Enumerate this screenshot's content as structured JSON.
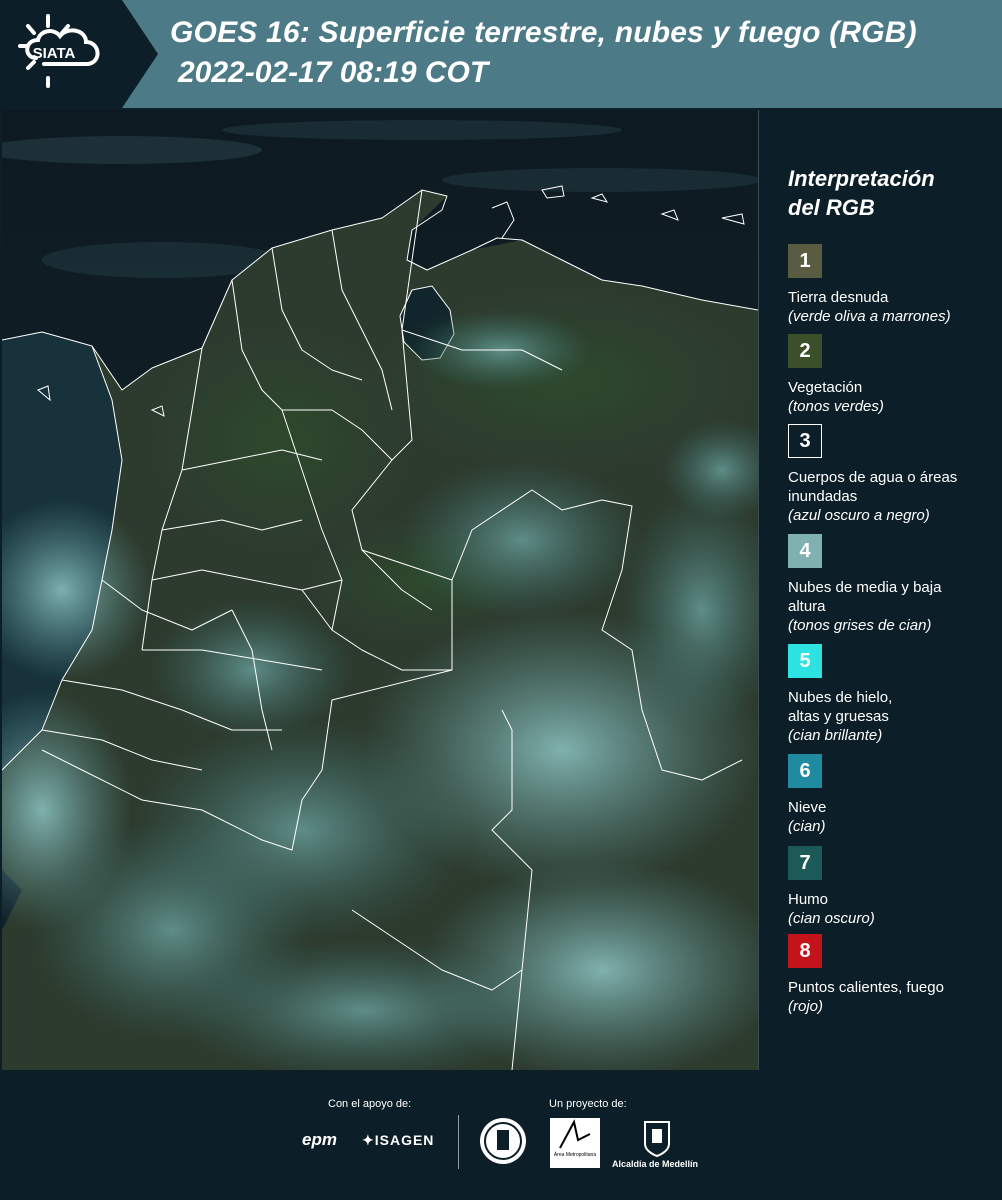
{
  "header": {
    "logo_text": "SIATA",
    "title": "GOES 16: Superficie terrestre, nubes y fuego (RGB)",
    "subtitle": "2022-02-17 08:19 COT"
  },
  "legend": {
    "title_line1": "Interpretación",
    "title_line2": "del RGB",
    "items": [
      {
        "num": "1",
        "label": "Tierra desnuda",
        "sub": "(verde oliva a marrones)",
        "color": "#5a5c42"
      },
      {
        "num": "2",
        "label": "Vegetación",
        "sub": "(tonos verdes)",
        "color": "#3b4f2a"
      },
      {
        "num": "3",
        "label": "Cuerpos de agua o áreas inundadas",
        "sub": "(azul oscuro a negro)",
        "color": "#0c1e27"
      },
      {
        "num": "4",
        "label": "Nubes de media y baja altura",
        "sub": "(tonos grises de cian)",
        "color": "#80b1b1"
      },
      {
        "num": "5",
        "label": "Nubes de hielo, altas y gruesas",
        "sub": "(cian brillante)",
        "color": "#2fe2e2"
      },
      {
        "num": "6",
        "label": "Nieve",
        "sub": "(cian)",
        "color": "#1f8aa0"
      },
      {
        "num": "7",
        "label": "Humo",
        "sub": "(cian oscuro)",
        "color": "#1c5a5a"
      },
      {
        "num": "8",
        "label": "Puntos calientes, fuego",
        "sub": "(rojo)",
        "color": "#c4141b"
      }
    ]
  },
  "footer": {
    "support_caption": "Con el apoyo de:",
    "project_caption": "Un proyecto de:",
    "epm_logo": "epm",
    "isagen_logo": "ISAGEN",
    "area_logo": "Área Metropolitana",
    "alcaldia_logo": "Alcaldía de Medellín"
  },
  "colors": {
    "background": "#0c1e27",
    "header_band": "#4c7a86",
    "sea": "#0e1e27",
    "land": "#2f3d2f",
    "cloud": "#6fa8a8"
  }
}
